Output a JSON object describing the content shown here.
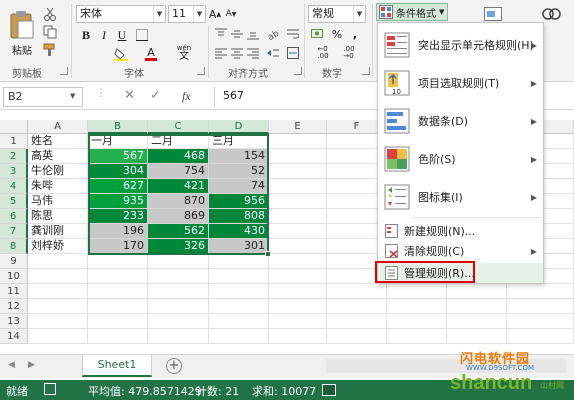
{
  "ribbon": {
    "paste_label": "粘贴",
    "font_name": "宋体",
    "font_size": "11",
    "number_format": "常规",
    "cond_format_label": "条件格式",
    "wen_char": "wén",
    "groups": {
      "clipboard": "剪贴板",
      "font": "字体",
      "alignment": "对齐方式",
      "number": "数字"
    }
  },
  "formula_bar": {
    "name_box": "B2",
    "fx": "fx",
    "formula": "567"
  },
  "grid": {
    "columns": [
      "A",
      "B",
      "C",
      "D",
      "E",
      "F"
    ],
    "rows": [
      "1",
      "2",
      "3",
      "4",
      "5",
      "6",
      "7",
      "8",
      "9",
      "10",
      "11",
      "12",
      "13",
      "14"
    ],
    "header_cells": [
      "姓名",
      "一月",
      "二月",
      "三月"
    ],
    "names": [
      "高英",
      "牛伦刚",
      "朱哔",
      "马伟",
      "陈思",
      "龚训刚",
      "刘梓娇"
    ],
    "data": [
      [
        "567",
        "468",
        "154"
      ],
      [
        "304",
        "754",
        "52"
      ],
      [
        "627",
        "421",
        "74"
      ],
      [
        "935",
        "870",
        "956"
      ],
      [
        "233",
        "869",
        "808"
      ],
      [
        "196",
        "562",
        "430"
      ],
      [
        "170",
        "326",
        "301"
      ]
    ]
  },
  "menu": {
    "items": [
      {
        "label": "突出显示单元格规则(H)",
        "icon": "highlight-rules-icon"
      },
      {
        "label": "项目选取规则(T)",
        "icon": "top-bottom-rules-icon"
      },
      {
        "label": "数据条(D)",
        "icon": "data-bars-icon"
      },
      {
        "label": "色阶(S)",
        "icon": "color-scales-icon"
      },
      {
        "label": "图标集(I)",
        "icon": "icon-sets-icon"
      }
    ],
    "new_rule": "新建规则(N)...",
    "clear_rules": "清除规则(C)",
    "manage_rules": "管理规则(R)..."
  },
  "sheet_tab": "Sheet1",
  "status": {
    "mode": "就绪",
    "average": "平均值: 479.8571429",
    "count": "计数: 21",
    "sum": "求和: 10077"
  },
  "watermark": {
    "line1": "闪电软件园",
    "line2": "shancun",
    "line3": "WWW.D9SOFT.COM",
    "suffix": "山村网"
  },
  "colors": {
    "excel_green": "#217346",
    "highlight_red": "#e00000",
    "dark_green": "#00883a",
    "light_gray": "#c8c8c8"
  }
}
